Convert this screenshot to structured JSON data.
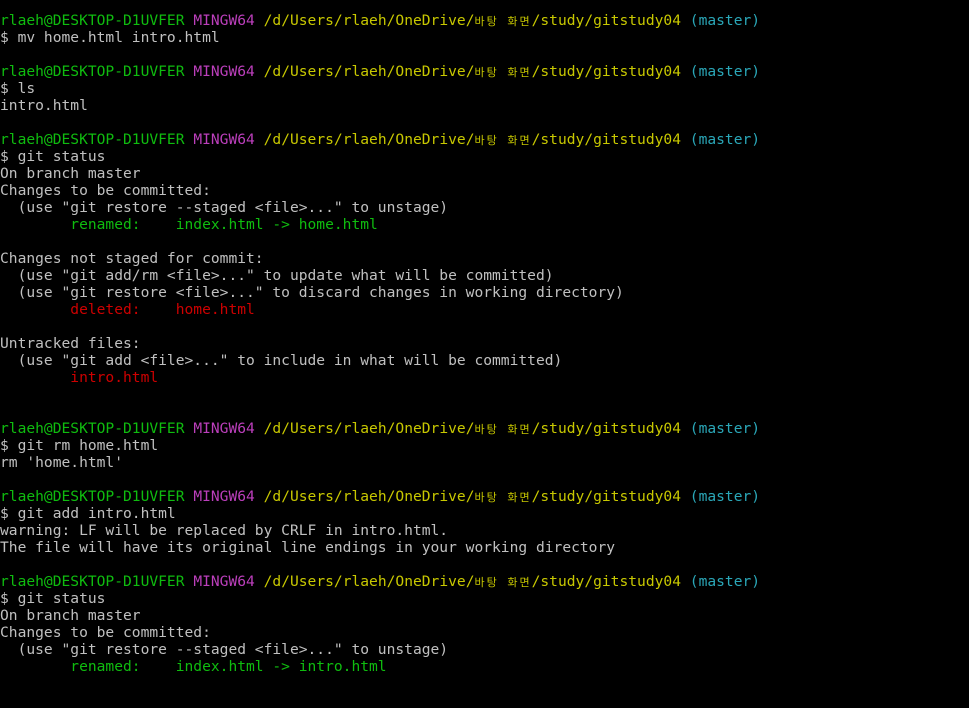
{
  "colors": {
    "background": "#000000",
    "text": "#c0c0c0",
    "user_host": "#0fbc0f",
    "shell": "#bc3fbc",
    "path": "#c8c800",
    "branch": "#2aa7b8",
    "staged": "#0fbc0f",
    "unstaged": "#cd0000"
  },
  "prompt": {
    "user_host": "rlaeh@DESKTOP-D1UVFER",
    "shell": "MINGW64",
    "path_prefix": "/d/Users/rlaeh/OneDrive/",
    "path_korean": "바탕 화면",
    "path_suffix": "/study/gitstudy04",
    "branch": "(master)"
  },
  "lines": [
    {
      "type": "prompt"
    },
    {
      "type": "cmd",
      "text": "$ mv home.html intro.html"
    },
    {
      "type": "blank"
    },
    {
      "type": "prompt"
    },
    {
      "type": "cmd",
      "text": "$ ls"
    },
    {
      "type": "out",
      "text": "intro.html"
    },
    {
      "type": "blank"
    },
    {
      "type": "prompt"
    },
    {
      "type": "cmd",
      "text": "$ git status"
    },
    {
      "type": "out",
      "text": "On branch master"
    },
    {
      "type": "out",
      "text": "Changes to be committed:"
    },
    {
      "type": "out",
      "text": "  (use \"git restore --staged <file>...\" to unstage)"
    },
    {
      "type": "staged",
      "text": "        renamed:    index.html -> home.html"
    },
    {
      "type": "blank"
    },
    {
      "type": "out",
      "text": "Changes not staged for commit:"
    },
    {
      "type": "out",
      "text": "  (use \"git add/rm <file>...\" to update what will be committed)"
    },
    {
      "type": "out",
      "text": "  (use \"git restore <file>...\" to discard changes in working directory)"
    },
    {
      "type": "unstaged",
      "text": "        deleted:    home.html"
    },
    {
      "type": "blank"
    },
    {
      "type": "out",
      "text": "Untracked files:"
    },
    {
      "type": "out",
      "text": "  (use \"git add <file>...\" to include in what will be committed)"
    },
    {
      "type": "unstaged",
      "text": "        intro.html"
    },
    {
      "type": "blank"
    },
    {
      "type": "blank"
    },
    {
      "type": "prompt"
    },
    {
      "type": "cmd",
      "text": "$ git rm home.html"
    },
    {
      "type": "out",
      "text": "rm 'home.html'"
    },
    {
      "type": "blank"
    },
    {
      "type": "prompt"
    },
    {
      "type": "cmd",
      "text": "$ git add intro.html"
    },
    {
      "type": "out",
      "text": "warning: LF will be replaced by CRLF in intro.html."
    },
    {
      "type": "out",
      "text": "The file will have its original line endings in your working directory"
    },
    {
      "type": "blank"
    },
    {
      "type": "prompt"
    },
    {
      "type": "cmd",
      "text": "$ git status"
    },
    {
      "type": "out",
      "text": "On branch master"
    },
    {
      "type": "out",
      "text": "Changes to be committed:"
    },
    {
      "type": "out",
      "text": "  (use \"git restore --staged <file>...\" to unstage)"
    },
    {
      "type": "staged",
      "text": "        renamed:    index.html -> intro.html"
    }
  ]
}
